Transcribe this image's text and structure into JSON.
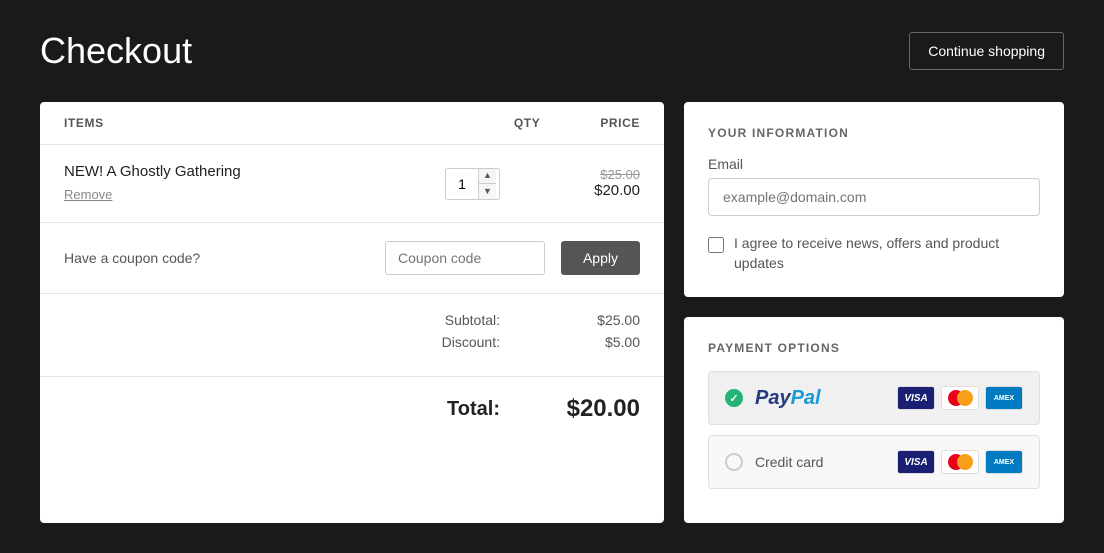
{
  "page": {
    "title": "Checkout",
    "continue_button": "Continue shopping"
  },
  "items_table": {
    "headers": {
      "items": "ITEMS",
      "qty": "QTY",
      "price": "PRICE"
    },
    "items": [
      {
        "name": "NEW! A Ghostly Gathering",
        "remove_label": "Remove",
        "qty": "1",
        "price_original": "$25.00",
        "price_discounted": "$20.00"
      }
    ]
  },
  "coupon": {
    "label": "Have a coupon code?",
    "placeholder": "Coupon code",
    "apply_button": "Apply"
  },
  "totals": {
    "subtotal_label": "Subtotal:",
    "subtotal_amount": "$25.00",
    "discount_label": "Discount:",
    "discount_amount": "$5.00",
    "total_label": "Total:",
    "total_amount": "$20.00"
  },
  "your_information": {
    "section_title": "YOUR INFORMATION",
    "email_label": "Email",
    "email_placeholder": "example@domain.com",
    "checkbox_label": "I agree to receive news, offers and product updates"
  },
  "payment_options": {
    "section_title": "PAYMENT OPTIONS",
    "options": [
      {
        "id": "paypal",
        "name": "PayPal",
        "selected": true
      },
      {
        "id": "credit-card",
        "name": "Credit card",
        "selected": false
      }
    ]
  }
}
